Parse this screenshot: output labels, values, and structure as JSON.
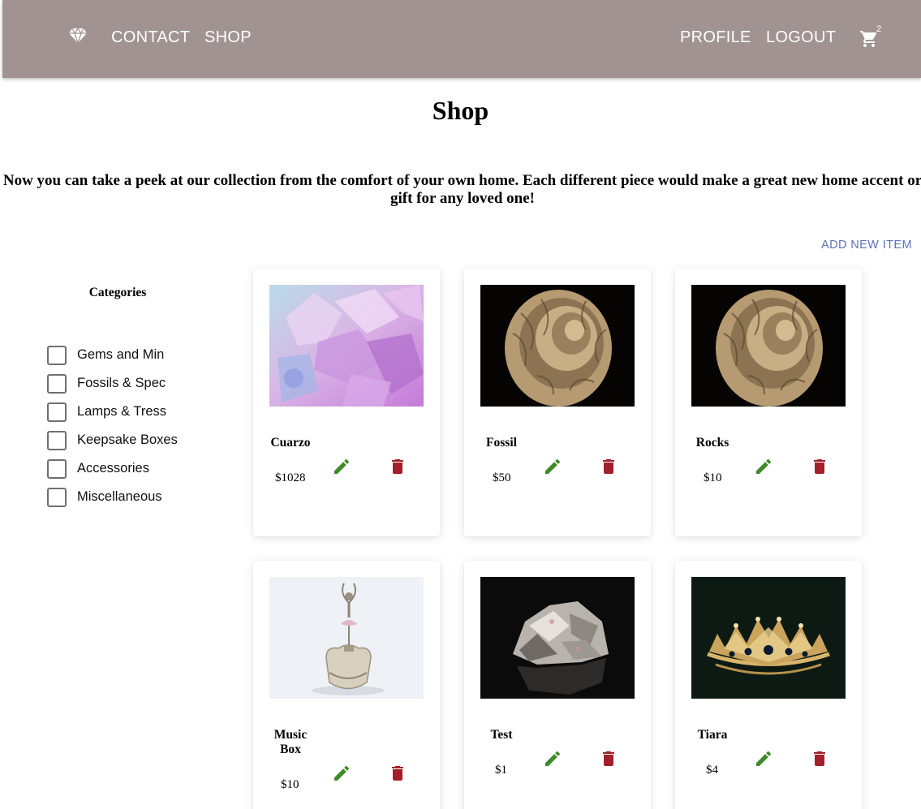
{
  "nav": {
    "contact": "CONTACT",
    "shop": "SHOP",
    "profile": "PROFILE",
    "logout": "LOGOUT",
    "cart_count": "2",
    "logo_icon": "diamond-icon",
    "cart_icon": "cart-icon"
  },
  "page": {
    "title": "Shop",
    "intro": "Now you can take a peek at our collection from the comfort of your own home. Each different piece would make a great new home accent or gift for any loved one!",
    "add_item": "ADD NEW ITEM"
  },
  "categories": {
    "title": "Categories",
    "items": [
      {
        "label": "Gems and Min",
        "checked": false
      },
      {
        "label": "Fossils & Spec",
        "checked": false
      },
      {
        "label": "Lamps & Tress",
        "checked": false
      },
      {
        "label": "Keepsake Boxes",
        "checked": false
      },
      {
        "label": "Accessories",
        "checked": false
      },
      {
        "label": "Miscellaneous",
        "checked": false
      }
    ]
  },
  "products": [
    {
      "name": "Cuarzo",
      "price": "$1028",
      "image": "amethyst-quartz"
    },
    {
      "name": "Fossil",
      "price": "$50",
      "image": "ammonite-fossil"
    },
    {
      "name": "Rocks",
      "price": "$10",
      "image": "ammonite-fossil"
    },
    {
      "name": "Music Box",
      "price": "$10",
      "image": "ballerina-music-box"
    },
    {
      "name": "Test",
      "price": "$1",
      "image": "mineral-rock"
    },
    {
      "name": "Tiara",
      "price": "$4",
      "image": "gold-tiara"
    }
  ],
  "colors": {
    "header": "#a19391",
    "link": "#5b74b8",
    "edit": "#3f8a2a",
    "delete": "#a31f2a"
  }
}
